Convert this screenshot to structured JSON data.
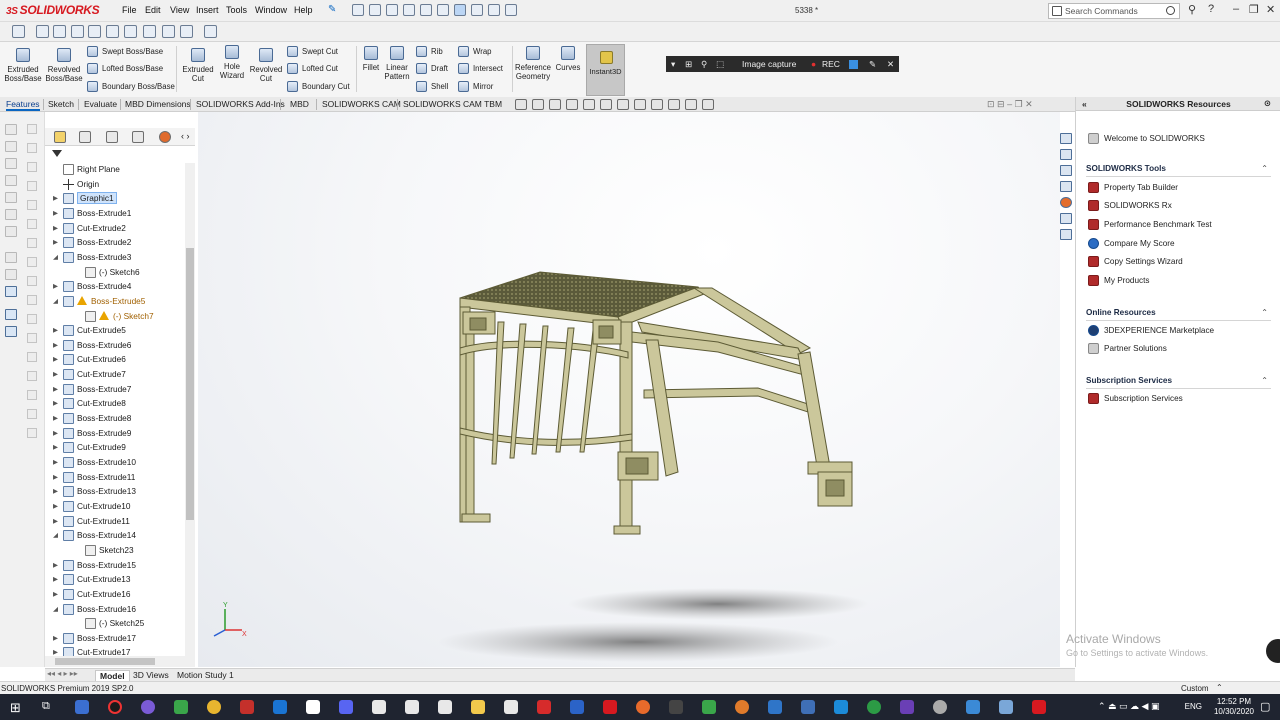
{
  "app": {
    "logo": "SOLIDWORKS",
    "logo_prefix": "3S",
    "document_title": "5338 *",
    "menu": [
      "File",
      "Edit",
      "View",
      "Insert",
      "Tools",
      "Window",
      "Help"
    ],
    "search_placeholder": "Search Commands"
  },
  "ribbon": {
    "extruded_boss": "Extruded Boss/Base",
    "revolved_boss": "Revolved Boss/Base",
    "swept_boss": "Swept Boss/Base",
    "lofted_boss": "Lofted Boss/Base",
    "boundary_boss": "Boundary Boss/Base",
    "extruded_cut": "Extruded Cut",
    "hole_wizard": "Hole Wizard",
    "revolved_cut": "Revolved Cut",
    "swept_cut": "Swept Cut",
    "lofted_cut": "Lofted Cut",
    "boundary_cut": "Boundary Cut",
    "fillet": "Fillet",
    "linear_pattern": "Linear Pattern",
    "rib": "Rib",
    "draft": "Draft",
    "shell": "Shell",
    "wrap": "Wrap",
    "intersect": "Intersect",
    "mirror": "Mirror",
    "reference_geometry": "Reference Geometry",
    "curves": "Curves",
    "instant3d": "Instant3D"
  },
  "capture_bar": {
    "image_capture": "Image capture",
    "rec": "REC"
  },
  "tabs": [
    "Features",
    "Sketch",
    "Evaluate",
    "MBD Dimensions",
    "SOLIDWORKS Add-Ins",
    "MBD",
    "SOLIDWORKS CAM",
    "SOLIDWORKS CAM TBM"
  ],
  "tree": [
    {
      "label": "Right Plane",
      "type": "plane",
      "exp": "",
      "indent": 0
    },
    {
      "label": "Origin",
      "type": "origin",
      "exp": "",
      "indent": 0
    },
    {
      "label": "Graphic1",
      "type": "feature",
      "exp": "▶",
      "indent": 0,
      "selected": true
    },
    {
      "label": "Boss-Extrude1",
      "type": "feature",
      "exp": "▶",
      "indent": 0
    },
    {
      "label": "Cut-Extrude2",
      "type": "feature",
      "exp": "▶",
      "indent": 0
    },
    {
      "label": "Boss-Extrude2",
      "type": "feature",
      "exp": "▶",
      "indent": 0
    },
    {
      "label": "Boss-Extrude3",
      "type": "feature",
      "exp": "◢",
      "indent": 0
    },
    {
      "label": "(-) Sketch6",
      "type": "sketch",
      "exp": "",
      "indent": 1
    },
    {
      "label": "Boss-Extrude4",
      "type": "feature",
      "exp": "▶",
      "indent": 0
    },
    {
      "label": "Boss-Extrude5",
      "type": "feature",
      "exp": "◢",
      "indent": 0,
      "warn": true
    },
    {
      "label": "(-) Sketch7",
      "type": "sketch",
      "exp": "",
      "indent": 1,
      "warn": true
    },
    {
      "label": "Cut-Extrude5",
      "type": "feature",
      "exp": "▶",
      "indent": 0
    },
    {
      "label": "Boss-Extrude6",
      "type": "feature",
      "exp": "▶",
      "indent": 0
    },
    {
      "label": "Cut-Extrude6",
      "type": "feature",
      "exp": "▶",
      "indent": 0
    },
    {
      "label": "Cut-Extrude7",
      "type": "feature",
      "exp": "▶",
      "indent": 0
    },
    {
      "label": "Boss-Extrude7",
      "type": "feature",
      "exp": "▶",
      "indent": 0
    },
    {
      "label": "Cut-Extrude8",
      "type": "feature",
      "exp": "▶",
      "indent": 0
    },
    {
      "label": "Boss-Extrude8",
      "type": "feature",
      "exp": "▶",
      "indent": 0
    },
    {
      "label": "Boss-Extrude9",
      "type": "feature",
      "exp": "▶",
      "indent": 0
    },
    {
      "label": "Cut-Extrude9",
      "type": "feature",
      "exp": "▶",
      "indent": 0
    },
    {
      "label": "Boss-Extrude10",
      "type": "feature",
      "exp": "▶",
      "indent": 0
    },
    {
      "label": "Boss-Extrude11",
      "type": "feature",
      "exp": "▶",
      "indent": 0
    },
    {
      "label": "Boss-Extrude13",
      "type": "feature",
      "exp": "▶",
      "indent": 0
    },
    {
      "label": "Cut-Extrude10",
      "type": "feature",
      "exp": "▶",
      "indent": 0
    },
    {
      "label": "Cut-Extrude11",
      "type": "feature",
      "exp": "▶",
      "indent": 0
    },
    {
      "label": "Boss-Extrude14",
      "type": "feature",
      "exp": "◢",
      "indent": 0
    },
    {
      "label": "Sketch23",
      "type": "sketch",
      "exp": "",
      "indent": 1
    },
    {
      "label": "Boss-Extrude15",
      "type": "feature",
      "exp": "▶",
      "indent": 0
    },
    {
      "label": "Cut-Extrude13",
      "type": "feature",
      "exp": "▶",
      "indent": 0
    },
    {
      "label": "Cut-Extrude16",
      "type": "feature",
      "exp": "▶",
      "indent": 0
    },
    {
      "label": "Boss-Extrude16",
      "type": "feature",
      "exp": "◢",
      "indent": 0
    },
    {
      "label": "(-) Sketch25",
      "type": "sketch",
      "exp": "",
      "indent": 1
    },
    {
      "label": "Boss-Extrude17",
      "type": "feature",
      "exp": "▶",
      "indent": 0
    },
    {
      "label": "Cut-Extrude17",
      "type": "feature",
      "exp": "▶",
      "indent": 0
    }
  ],
  "taskpane": {
    "title": "SOLIDWORKS Resources",
    "welcome": "Welcome to SOLIDWORKS",
    "tools_title": "SOLIDWORKS Tools",
    "tools": [
      "Property Tab Builder",
      "SOLIDWORKS Rx",
      "Performance Benchmark Test",
      "Compare My Score",
      "Copy Settings Wizard",
      "My Products"
    ],
    "online_title": "Online Resources",
    "online": [
      "3DEXPERIENCE Marketplace",
      "Partner Solutions"
    ],
    "subs_title": "Subscription Services",
    "subs": [
      "Subscription Services"
    ]
  },
  "watermark": {
    "line1": "Activate Windows",
    "line2": "Go to Settings to activate Windows."
  },
  "bottom_tabs": [
    "Model",
    "3D Views",
    "Motion Study 1"
  ],
  "status": {
    "left": "SOLIDWORKS Premium 2019 SP2.0",
    "units": "Custom"
  },
  "taskbar": {
    "lang": "ENG",
    "time": "12:52 PM",
    "date": "10/30/2020"
  },
  "triad": {
    "x": "X",
    "y": "Y"
  },
  "colors": {
    "model": "#c9c79a",
    "model_dark": "#6f6d3c",
    "accent": "#d71920"
  }
}
